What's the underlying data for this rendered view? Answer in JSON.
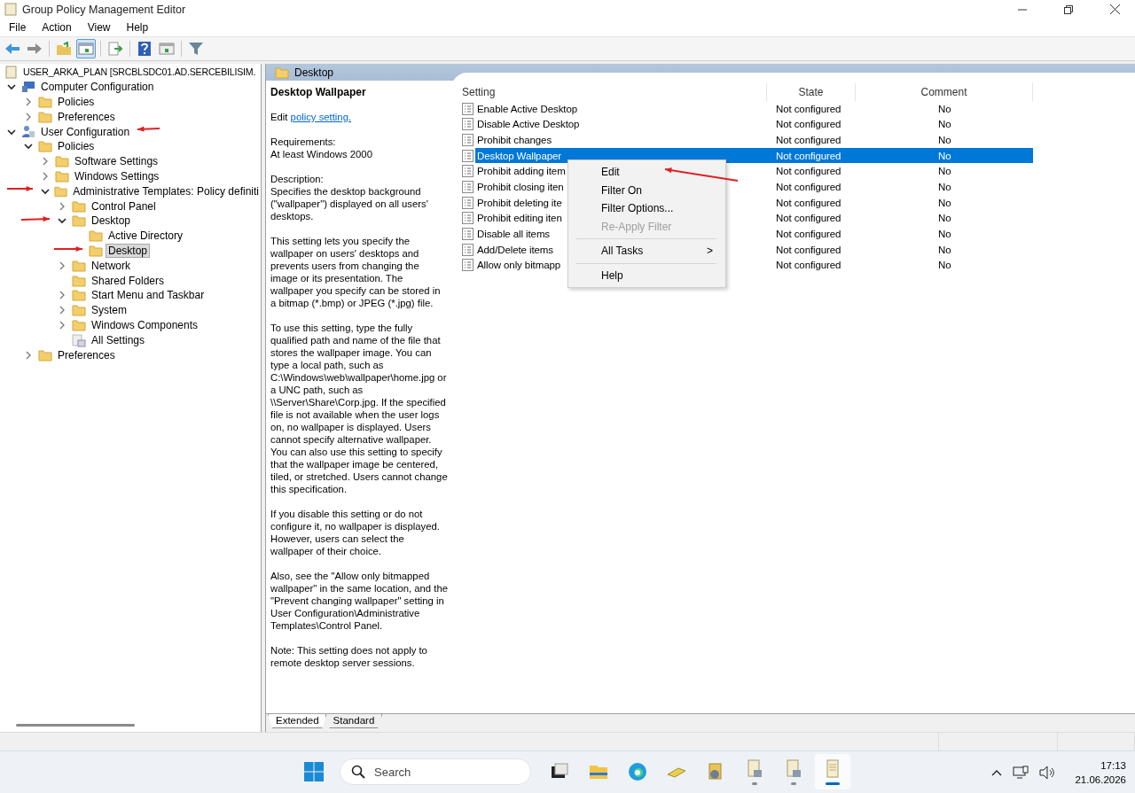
{
  "window": {
    "title": "Group Policy Management Editor"
  },
  "menu": [
    "File",
    "Action",
    "View",
    "Help"
  ],
  "toolbar": [
    {
      "kind": "back",
      "pressed": false
    },
    {
      "kind": "forward",
      "pressed": false
    },
    {
      "kind": "up",
      "pressed": false
    },
    {
      "kind": "tree",
      "pressed": true
    },
    {
      "kind": "export",
      "pressed": false
    },
    {
      "kind": "help",
      "pressed": false
    },
    {
      "kind": "view",
      "pressed": false
    },
    {
      "kind": "filter",
      "pressed": false
    }
  ],
  "tree": {
    "label": "USER_ARKA_PLAN [SRCBLSDC01.AD.SERCEBILISIM.",
    "kind": "gpo",
    "selected": false,
    "children": [
      {
        "label": "Computer Configuration",
        "kind": "computer",
        "expanded": true,
        "selected": false,
        "children": [
          {
            "label": "Policies",
            "kind": "folder",
            "expanded": false,
            "selected": false
          },
          {
            "label": "Preferences",
            "kind": "folder",
            "expanded": false,
            "selected": false
          }
        ]
      },
      {
        "label": "User Configuration",
        "kind": "user",
        "expanded": true,
        "selected": false,
        "children": [
          {
            "label": "Policies",
            "kind": "folder",
            "expanded": true,
            "selected": false,
            "children": [
              {
                "label": "Software Settings",
                "kind": "folder",
                "expanded": false,
                "selected": false
              },
              {
                "label": "Windows Settings",
                "kind": "folder",
                "expanded": false,
                "selected": false
              },
              {
                "label": "Administrative Templates: Policy definiti",
                "kind": "folder",
                "expanded": true,
                "selected": false,
                "children": [
                  {
                    "label": "Control Panel",
                    "kind": "folder",
                    "expanded": false,
                    "selected": false
                  },
                  {
                    "label": "Desktop",
                    "kind": "folder",
                    "expanded": true,
                    "selected": false,
                    "children": [
                      {
                        "label": "Active Directory",
                        "kind": "folder",
                        "selected": false
                      },
                      {
                        "label": "Desktop",
                        "kind": "folder",
                        "selected": true
                      }
                    ]
                  },
                  {
                    "label": "Network",
                    "kind": "folder",
                    "expanded": false,
                    "selected": false
                  },
                  {
                    "label": "Shared Folders",
                    "kind": "folder",
                    "selected": false
                  },
                  {
                    "label": "Start Menu and Taskbar",
                    "kind": "folder",
                    "expanded": false,
                    "selected": false
                  },
                  {
                    "label": "System",
                    "kind": "folder",
                    "expanded": false,
                    "selected": false
                  },
                  {
                    "label": "Windows Components",
                    "kind": "folder",
                    "expanded": false,
                    "selected": false
                  },
                  {
                    "label": "All Settings",
                    "kind": "settings",
                    "selected": false
                  }
                ]
              }
            ]
          },
          {
            "label": "Preferences",
            "kind": "folder",
            "expanded": false,
            "selected": false
          }
        ]
      }
    ]
  },
  "panel": {
    "title": "Desktop",
    "description": {
      "title": "Desktop Wallpaper",
      "edit_prefix": "Edit",
      "edit_link": "policy setting.",
      "paragraphs": [
        "Requirements:\nAt least Windows 2000",
        "Description:\nSpecifies the desktop background (\"wallpaper\") displayed on all users' desktops.",
        "This setting lets you specify the wallpaper on users' desktops and prevents users from changing the image or its presentation. The wallpaper you specify can be stored in a bitmap (*.bmp) or JPEG (*.jpg) file.",
        "To use this setting, type the fully qualified path and name of the file that stores the wallpaper image. You can type a local path, such as C:\\Windows\\web\\wallpaper\\home.jpg or a UNC path, such as \\\\Server\\Share\\Corp.jpg. If the specified file is not available when the user logs on, no wallpaper is displayed. Users cannot specify alternative wallpaper. You can also use this setting to specify that the wallpaper image be centered, tiled, or stretched. Users cannot change this specification.",
        "If you disable this setting or do not configure it, no wallpaper is displayed. However, users can select the wallpaper of their choice.",
        "Also, see the \"Allow only bitmapped wallpaper\" in the same location, and the \"Prevent changing wallpaper\" setting in User Configuration\\Administrative Templates\\Control Panel.",
        "Note: This setting does not apply to remote desktop server sessions."
      ]
    },
    "columns": [
      "Setting",
      "State",
      "Comment"
    ],
    "rows": [
      {
        "setting": "Enable Active Desktop",
        "state": "Not configured",
        "comment": "No",
        "selected": false
      },
      {
        "setting": "Disable Active Desktop",
        "state": "Not configured",
        "comment": "No",
        "selected": false
      },
      {
        "setting": "Prohibit changes",
        "state": "Not configured",
        "comment": "No",
        "selected": false
      },
      {
        "setting": "Desktop Wallpaper",
        "state": "Not configured",
        "comment": "No",
        "selected": true
      },
      {
        "setting": "Prohibit adding item",
        "state": "Not configured",
        "comment": "No",
        "selected": false
      },
      {
        "setting": "Prohibit closing iten",
        "state": "Not configured",
        "comment": "No",
        "selected": false
      },
      {
        "setting": "Prohibit deleting ite",
        "state": "Not configured",
        "comment": "No",
        "selected": false
      },
      {
        "setting": "Prohibit editing iten",
        "state": "Not configured",
        "comment": "No",
        "selected": false
      },
      {
        "setting": "Disable all items",
        "state": "Not configured",
        "comment": "No",
        "selected": false
      },
      {
        "setting": "Add/Delete items",
        "state": "Not configured",
        "comment": "No",
        "selected": false
      },
      {
        "setting": "Allow only bitmapp",
        "state": "Not configured",
        "comment": "No",
        "selected": false
      }
    ],
    "tabs": [
      {
        "label": "Extended",
        "selected": true
      },
      {
        "label": "Standard",
        "selected": false
      }
    ]
  },
  "context_menu": [
    {
      "kind": "item",
      "label": "Edit",
      "disabled": false
    },
    {
      "kind": "item",
      "label": "Filter On",
      "disabled": false
    },
    {
      "kind": "item",
      "label": "Filter Options...",
      "disabled": false
    },
    {
      "kind": "item",
      "label": "Re-Apply Filter",
      "disabled": true
    },
    {
      "kind": "separator"
    },
    {
      "kind": "submenu",
      "label": "All Tasks",
      "arrow": ">",
      "disabled": false
    },
    {
      "kind": "separator"
    },
    {
      "kind": "item",
      "label": "Help",
      "disabled": false
    }
  ],
  "taskbar": {
    "search_placeholder": "Search",
    "apps": [
      {
        "kind": "taskview",
        "running": false,
        "selected": false
      },
      {
        "kind": "explorer",
        "running": false,
        "selected": false
      },
      {
        "kind": "edge",
        "running": false,
        "selected": false
      },
      {
        "kind": "tool",
        "running": false,
        "selected": false
      },
      {
        "kind": "admin",
        "running": false,
        "selected": false
      },
      {
        "kind": "document",
        "running": true,
        "selected": false
      },
      {
        "kind": "document",
        "running": true,
        "selected": false
      },
      {
        "kind": "scroll",
        "running": true,
        "selected": true
      }
    ],
    "time": "17:13",
    "date": "21.06.2026"
  }
}
